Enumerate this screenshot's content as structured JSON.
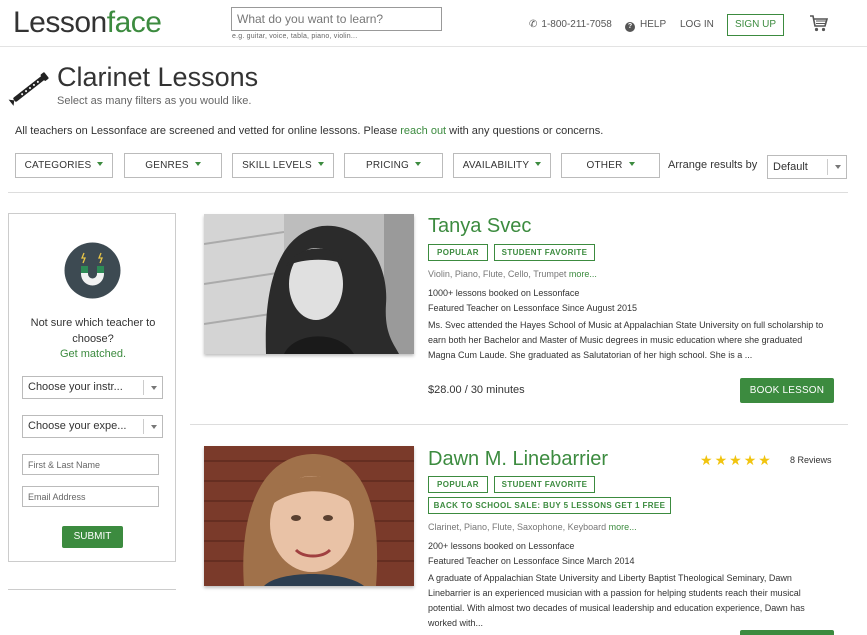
{
  "header": {
    "logo_main": "Lesson",
    "logo_accent": "face",
    "search_placeholder": "What do you want to learn?",
    "search_hint": "e.g. guitar, voice, tabla, piano, violin...",
    "phone": "1-800-211-7058",
    "help": "HELP",
    "login": "LOG IN",
    "signup": "SIGN UP",
    "cart_icon": "cart-icon"
  },
  "page": {
    "title": "Clarinet Lessons",
    "subtitle": "Select as many filters as you would like.",
    "vetted_before": "All teachers on Lessonface are screened and vetted for online lessons. Please ",
    "vetted_link": "reach out",
    "vetted_after": " with any questions or concerns."
  },
  "filters": {
    "items": [
      "CATEGORIES",
      "GENRES",
      "SKILL LEVELS",
      "PRICING",
      "AVAILABILITY",
      "OTHER"
    ],
    "arrange_label": "Arrange results by",
    "arrange_value": "Default"
  },
  "sidebar": {
    "prompt": "Not sure which teacher to choose?",
    "get_matched": "Get matched.",
    "instrument_select": "Choose your instr...",
    "experience_select": "Choose your expe...",
    "name_placeholder": "First & Last Name",
    "email_placeholder": "Email Address",
    "submit": "SUBMIT"
  },
  "teachers": [
    {
      "name": "Tanya Svec",
      "badges": [
        "POPULAR",
        "STUDENT FAVORITE"
      ],
      "instruments": "Violin, Piano, Flute, Cello, Trumpet",
      "more": "more...",
      "lessons": "1000+ lessons booked on Lessonface",
      "featured": "Featured Teacher on Lessonface Since August 2015",
      "bio": "Ms. Svec attended the Hayes School of Music at Appalachian State University on full scholarship to earn both her Bachelor and Master of Music degrees in music education where she graduated Magna Cum Laude.  She graduated as Salutatorian of her high school.  She is a ...",
      "price": "$28.00 / 30 minutes",
      "book": "BOOK LESSON"
    },
    {
      "name": "Dawn M. Linebarrier",
      "badges": [
        "POPULAR",
        "STUDENT FAVORITE"
      ],
      "promo": "BACK TO SCHOOL SALE: BUY 5 LESSONS GET 1 FREE",
      "rating": 5,
      "reviews": "8 Reviews",
      "instruments": "Clarinet, Piano, Flute, Saxophone, Keyboard",
      "more": "more...",
      "lessons": "200+ lessons booked on Lessonface",
      "featured": "Featured Teacher on Lessonface Since March 2014",
      "bio": "A graduate of Appalachian State University and Liberty Baptist Theological Seminary, Dawn Linebarrier is an experienced musician with a passion for helping students reach their musical potential. With almost two decades of musical leadership and education experience, Dawn has worked with..."
    }
  ],
  "colors": {
    "brand_green": "#3c8b3f",
    "star_yellow": "#f1c40f"
  }
}
